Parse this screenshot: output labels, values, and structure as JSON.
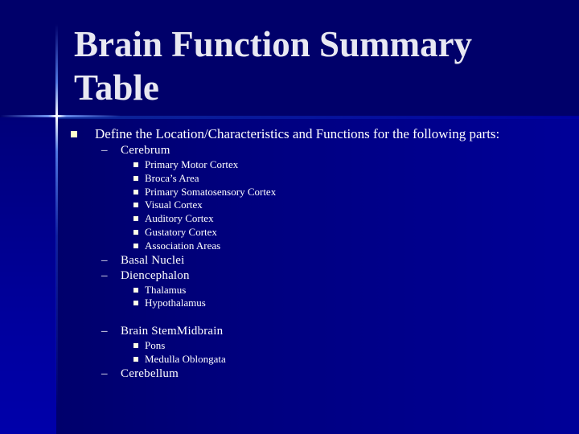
{
  "slide": {
    "title": "Brain Function Summary Table",
    "colors": {
      "background": "#00006a",
      "title_text": "#e8e8f2",
      "body_text": "#ffffff",
      "bullet": "#ffffcc"
    },
    "main_bullet": {
      "icon": "square-bullet-icon",
      "text": "Define the Location/Characteristics and Functions for the following parts:"
    },
    "sections": [
      {
        "label": "Cerebrum",
        "items": [
          "Primary Motor Cortex",
          "Broca’s Area",
          "Primary Somatosensory Cortex",
          "Visual Cortex",
          "Auditory Cortex",
          "Gustatory Cortex",
          "Association Areas"
        ]
      },
      {
        "label": "Basal Nuclei",
        "items": []
      },
      {
        "label": "Diencephalon",
        "items": [
          "Thalamus",
          "Hypothalamus"
        ]
      },
      {
        "label": "Brain StemMidbrain",
        "items": [
          "Pons",
          "Medulla Oblongata"
        ]
      },
      {
        "label": "Cerebellum",
        "items": []
      }
    ],
    "dash_symbol": "–"
  }
}
